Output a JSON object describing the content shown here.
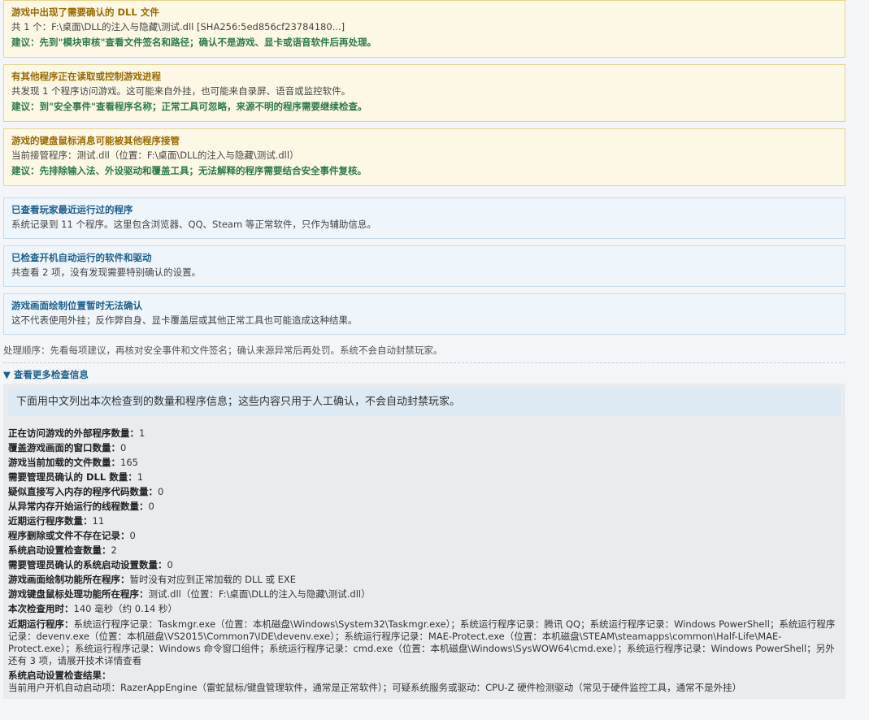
{
  "warnings": [
    {
      "title": "游戏中出现了需要确认的 DLL 文件",
      "body": "共 1 个：F:\\桌面\\DLL的注入与隐藏\\测试.dll [SHA256:5ed856cf23784180...]",
      "advice": "建议：先到\"模块审核\"查看文件签名和路径；确认不是游戏、显卡或语音软件后再处理。"
    },
    {
      "title": "有其他程序正在读取或控制游戏进程",
      "body": "共发现 1 个程序访问游戏。这可能来自外挂，也可能来自录屏、语音或监控软件。",
      "advice": "建议：到\"安全事件\"查看程序名称；正常工具可忽略，来源不明的程序需要继续检查。"
    },
    {
      "title": "游戏的键盘鼠标消息可能被其他程序接管",
      "body": "当前接管程序：测试.dll（位置：F:\\桌面\\DLL的注入与隐藏\\测试.dll）",
      "advice": "建议：先排除输入法、外设驱动和覆盖工具；无法解释的程序需要结合安全事件复核。"
    }
  ],
  "infos": [
    {
      "title": "已查看玩家最近运行过的程序",
      "body": "系统记录到 11 个程序。这里包含浏览器、QQ、Steam 等正常软件，只作为辅助信息。"
    },
    {
      "title": "已检查开机自动运行的软件和驱动",
      "body": "共查看 2 项，没有发现需要特别确认的设置。"
    },
    {
      "title": "游戏画面绘制位置暂时无法确认",
      "body": "这不代表使用外挂；反作弊自身、显卡覆盖层或其他正常工具也可能造成这种结果。"
    }
  ],
  "process_note": "处理顺序：先看每项建议，再核对安全事件和文件签名；确认来源异常后再处罚。系统不会自动封禁玩家。",
  "toggle_label": "▼ 查看更多检查信息",
  "details": {
    "intro": "下面用中文列出本次检查到的数量和程序信息；这些内容只用于人工确认，不会自动封禁玩家。",
    "stats": [
      {
        "label": "正在访问游戏的外部程序数量：",
        "value": "1"
      },
      {
        "label": "覆盖游戏画面的窗口数量：",
        "value": "0"
      },
      {
        "label": "游戏当前加载的文件数量：",
        "value": "165"
      },
      {
        "label": "需要管理员确认的 DLL 数量：",
        "value": "1"
      },
      {
        "label": "疑似直接写入内存的程序代码数量：",
        "value": "0"
      },
      {
        "label": "从异常内存开始运行的线程数量：",
        "value": "0"
      },
      {
        "label": "近期运行程序数量：",
        "value": "11"
      },
      {
        "label": "程序删除或文件不存在记录：",
        "value": "0"
      },
      {
        "label": "系统启动设置检查数量：",
        "value": "2"
      },
      {
        "label": "需要管理员确认的系统启动设置数量：",
        "value": "0"
      },
      {
        "label": "游戏画面绘制功能所在程序：",
        "value": "暂时没有对应到正常加载的 DLL 或 EXE"
      },
      {
        "label": "游戏键盘鼠标处理功能所在程序：",
        "value": "测试.dll（位置：F:\\桌面\\DLL的注入与隐藏\\测试.dll）"
      },
      {
        "label": "本次检查用时：",
        "value": "140 毫秒（约 0.14 秒）"
      }
    ],
    "recent_programs_label": "近期运行程序：",
    "recent_programs_value": "系统运行程序记录：Taskmgr.exe（位置：本机磁盘\\Windows\\System32\\Taskmgr.exe）；系统运行程序记录：腾讯 QQ；系统运行程序记录：Windows PowerShell；系统运行程序记录：devenv.exe（位置：本机磁盘\\VS2015\\Common7\\IDE\\devenv.exe）；系统运行程序记录：MAE-Protect.exe（位置：本机磁盘\\STEAM\\steamapps\\common\\Half-Life\\MAE-Protect.exe）；系统运行程序记录：Windows 命令窗口组件；系统运行程序记录：cmd.exe（位置：本机磁盘\\Windows\\SysWOW64\\cmd.exe）；系统运行程序记录：Windows PowerShell；另外还有 3 项，请展开技术详情查看",
    "startup_label": "系统启动设置检查结果：",
    "startup_value": "当前用户开机自动启动项：RazerAppEngine（雷蛇鼠标/键盘管理软件，通常是正常软件）；可疑系统服务或驱动：CPU-Z 硬件检测驱动（常见于硬件监控工具，通常不是外挂）"
  }
}
